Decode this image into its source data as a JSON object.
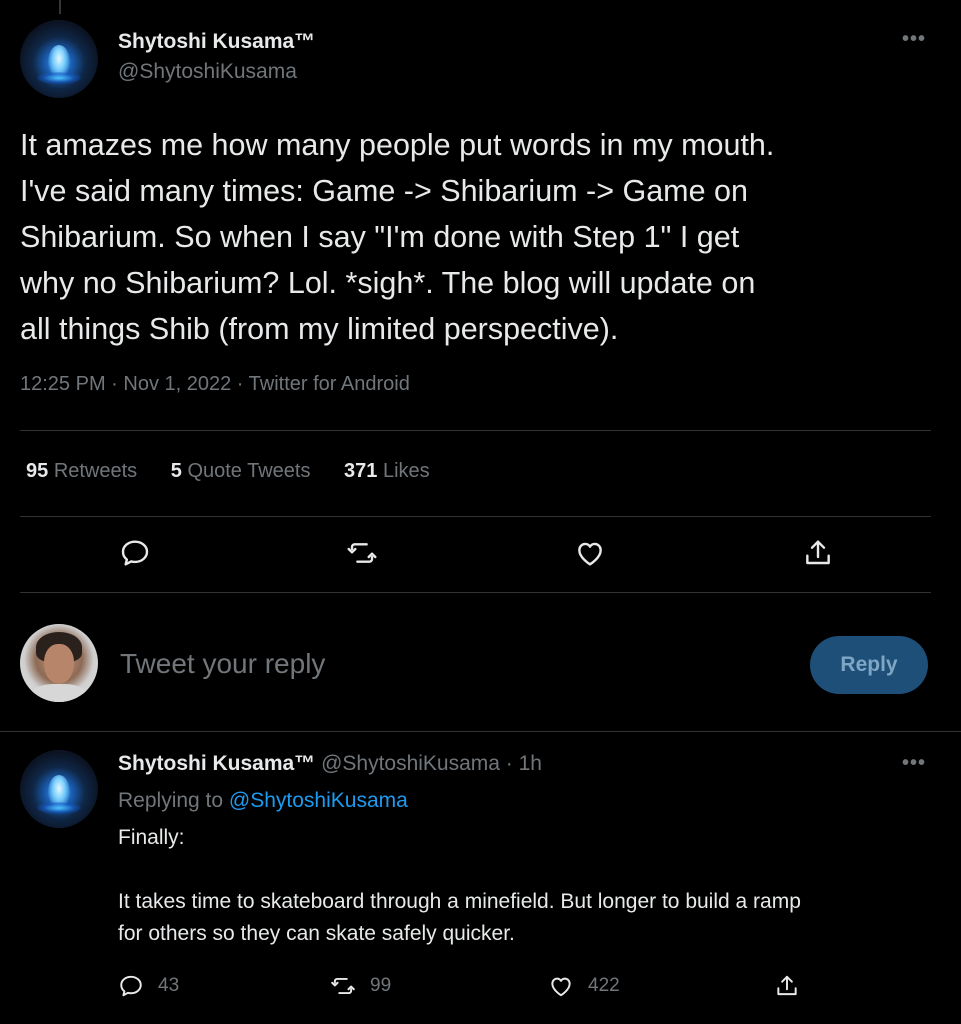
{
  "main_tweet": {
    "author_name": "Shytoshi Kusama™",
    "author_handle": "@ShytoshiKusama",
    "more_icon": "more-horizontal-icon",
    "text": "It amazes me how many people put words in my mouth.\nI've said many times: Game -> Shibarium -> Game on\nShibarium. So when I say \"I'm done with Step 1\" I get\nwhy no Shibarium? Lol. *sigh*. The blog will update on\nall things Shib (from my limited perspective).",
    "timestamp": "12:25 PM · Nov 1, 2022 · Twitter for Android",
    "stats": {
      "retweets_count": "95",
      "retweets_label": "Retweets",
      "quote_count": "5",
      "quote_label": "Quote Tweets",
      "likes_count": "371",
      "likes_label": "Likes"
    },
    "actions": [
      "reply-icon",
      "retweet-icon",
      "like-icon",
      "share-icon"
    ]
  },
  "reply_box": {
    "placeholder": "Tweet your reply",
    "button_label": "Reply"
  },
  "reply_tweet": {
    "author_name": "Shytoshi Kusama™",
    "author_handle": "@ShytoshiKusama · 1h",
    "replying_prefix": "Replying to ",
    "replying_to": "@ShytoshiKusama",
    "text": "Finally:\n\nIt takes time to skateboard through a minefield. But longer to build a ramp\nfor others so they can skate safely quicker.",
    "reply_count": "43",
    "retweet_count": "99",
    "like_count": "422"
  },
  "colors": {
    "background": "#000000",
    "text": "#e7e9ea",
    "muted": "#71767b",
    "link": "#1d9bf0",
    "divider": "#2f3336",
    "reply_button": "#1d4f78"
  }
}
